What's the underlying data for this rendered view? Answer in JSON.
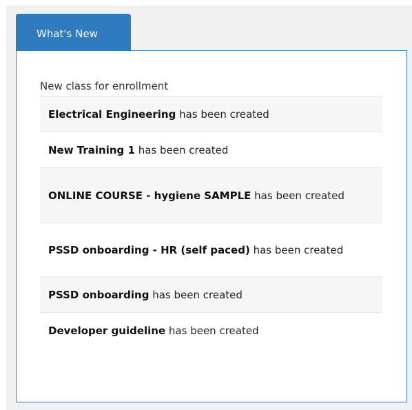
{
  "tab": {
    "label": "What's New"
  },
  "section": {
    "title": "New class for enrollment"
  },
  "items": [
    {
      "name": "Electrical Engineering",
      "suffix": " has been created"
    },
    {
      "name": "New Training 1",
      "suffix": " has been created"
    },
    {
      "name": "ONLINE COURSE - hygiene SAMPLE",
      "suffix": " has been created"
    },
    {
      "name": "PSSD onboarding - HR (self paced)",
      "suffix": " has been created"
    },
    {
      "name": "PSSD onboarding",
      "suffix": " has been created"
    },
    {
      "name": "Developer guideline",
      "suffix": " has been created"
    }
  ]
}
